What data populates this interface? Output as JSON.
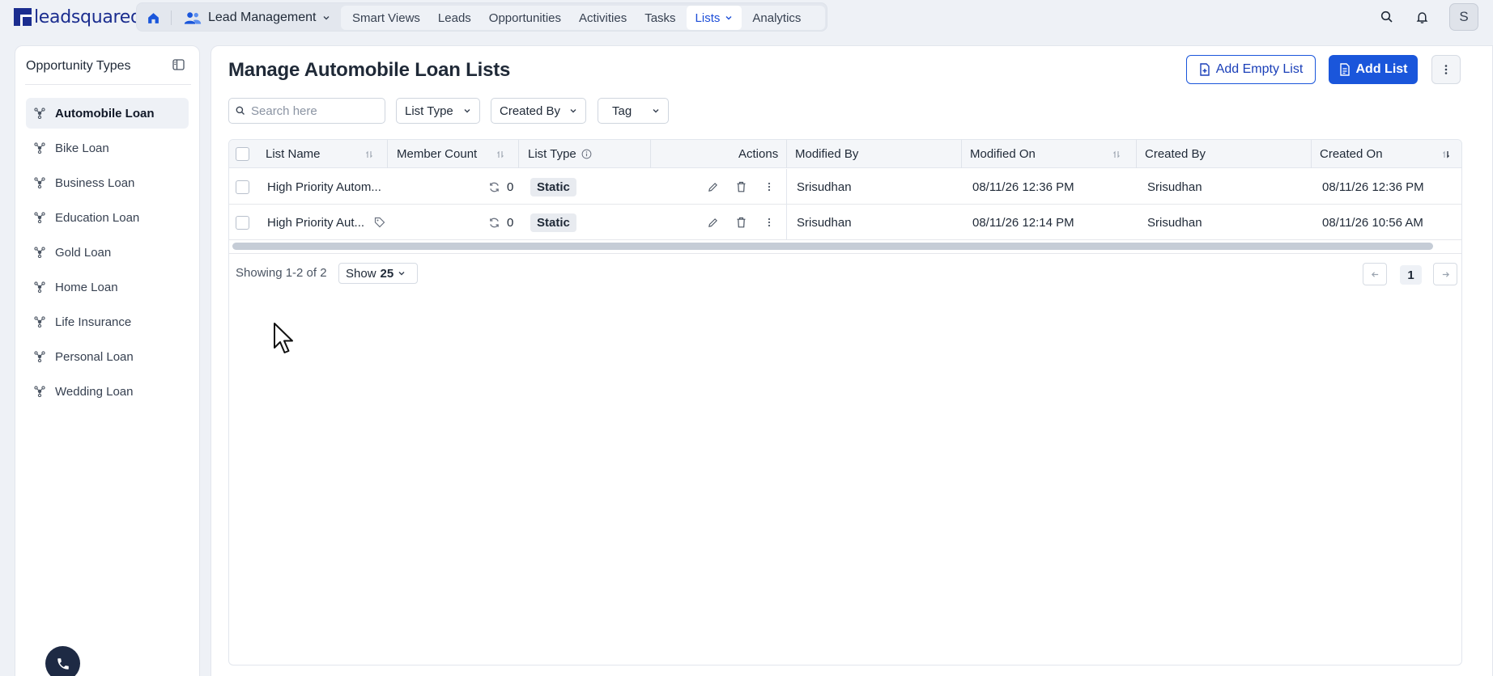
{
  "app": {
    "logo_text": "leadsquared",
    "module_label": "Lead Management",
    "avatar_initial": "S"
  },
  "nav": {
    "items": [
      {
        "label": "Smart Views"
      },
      {
        "label": "Leads"
      },
      {
        "label": "Opportunities"
      },
      {
        "label": "Activities"
      },
      {
        "label": "Tasks"
      },
      {
        "label": "Lists",
        "active": true
      },
      {
        "label": "Analytics"
      }
    ]
  },
  "sidebar": {
    "title": "Opportunity Types",
    "items": [
      {
        "label": "Automobile Loan",
        "active": true
      },
      {
        "label": "Bike Loan"
      },
      {
        "label": "Business Loan"
      },
      {
        "label": "Education Loan"
      },
      {
        "label": "Gold Loan"
      },
      {
        "label": "Home Loan"
      },
      {
        "label": "Life Insurance"
      },
      {
        "label": "Personal Loan"
      },
      {
        "label": "Wedding Loan"
      }
    ]
  },
  "main": {
    "title": "Manage Automobile Loan Lists",
    "add_empty_list_label": "Add Empty List",
    "add_list_label": "Add List",
    "search_placeholder": "Search here",
    "filters": {
      "list_type": "List Type",
      "created_by": "Created By",
      "tag": "Tag"
    }
  },
  "table": {
    "columns": {
      "list_name": "List Name",
      "member_count": "Member Count",
      "list_type": "List Type",
      "actions": "Actions",
      "modified_by": "Modified By",
      "modified_on": "Modified On",
      "created_by": "Created By",
      "created_on": "Created On"
    },
    "rows": [
      {
        "list_name": "High Priority Autom...",
        "member_count": "0",
        "list_type": "Static",
        "modified_by": "Srisudhan",
        "modified_on": "08/11/26 12:36 PM",
        "created_by": "Srisudhan",
        "created_on": "08/11/26 12:36 PM"
      },
      {
        "list_name": "High Priority Aut...",
        "member_count": "0",
        "list_type": "Static",
        "modified_by": "Srisudhan",
        "modified_on": "08/11/26 12:14 PM",
        "created_by": "Srisudhan",
        "created_on": "08/11/26 10:56 AM"
      }
    ]
  },
  "pagination": {
    "showing_text": "Showing 1-2 of 2",
    "show_label": "Show",
    "show_value": "25",
    "current_page": "1"
  },
  "colors": {
    "brand": "#1b2d8f",
    "accent": "#1a56db"
  }
}
